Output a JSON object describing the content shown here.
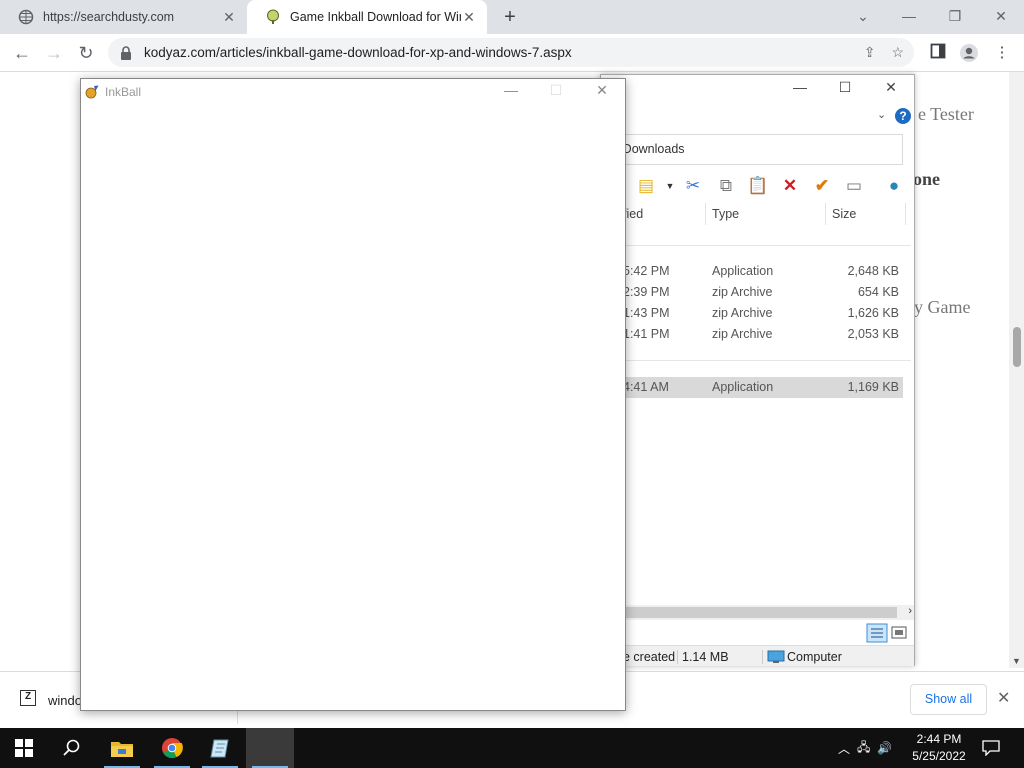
{
  "browser": {
    "tabs": [
      {
        "title": "https://searchdusty.com",
        "favicon": "globe-icon"
      },
      {
        "title": "Game Inkball Download for Windows",
        "favicon": "inkball-icon"
      }
    ],
    "address_url": "kodyaz.com/articles/inkball-game-download-for-xp-and-windows-7.aspx"
  },
  "page": {
    "visible_fragments": [
      "e Tester",
      "one",
      "y Game"
    ]
  },
  "download_bar": {
    "file_name": "windo",
    "show_all_label": "Show all"
  },
  "explorer": {
    "search_placeholder": "ch Downloads",
    "columns": [
      "fied",
      "Type",
      "Size"
    ],
    "rows": [
      {
        "modified": "5:42 PM",
        "type": "Application",
        "size": "2,648 KB",
        "selected": false
      },
      {
        "modified": "2:39 PM",
        "type": "zip Archive",
        "size": "654 KB",
        "selected": false
      },
      {
        "modified": "1:43 PM",
        "type": "zip Archive",
        "size": "1,626 KB",
        "selected": false
      },
      {
        "modified": "1:41 PM",
        "type": "zip Archive",
        "size": "2,053 KB",
        "selected": false
      },
      {
        "modified": "4:41 AM",
        "type": "Application",
        "size": "1,169 KB",
        "selected": true
      }
    ],
    "status": {
      "left": "e created",
      "size": "1.14 MB",
      "location": "Computer"
    }
  },
  "inkball": {
    "title": "InkBall"
  },
  "taskbar": {
    "time": "2:44 PM",
    "date": "5/25/2022"
  },
  "colors": {
    "tabstrip": "#dee1e6",
    "accent_blue": "#1a73e8",
    "selection_gray": "#d9d9d9",
    "taskbar": "#101010"
  }
}
